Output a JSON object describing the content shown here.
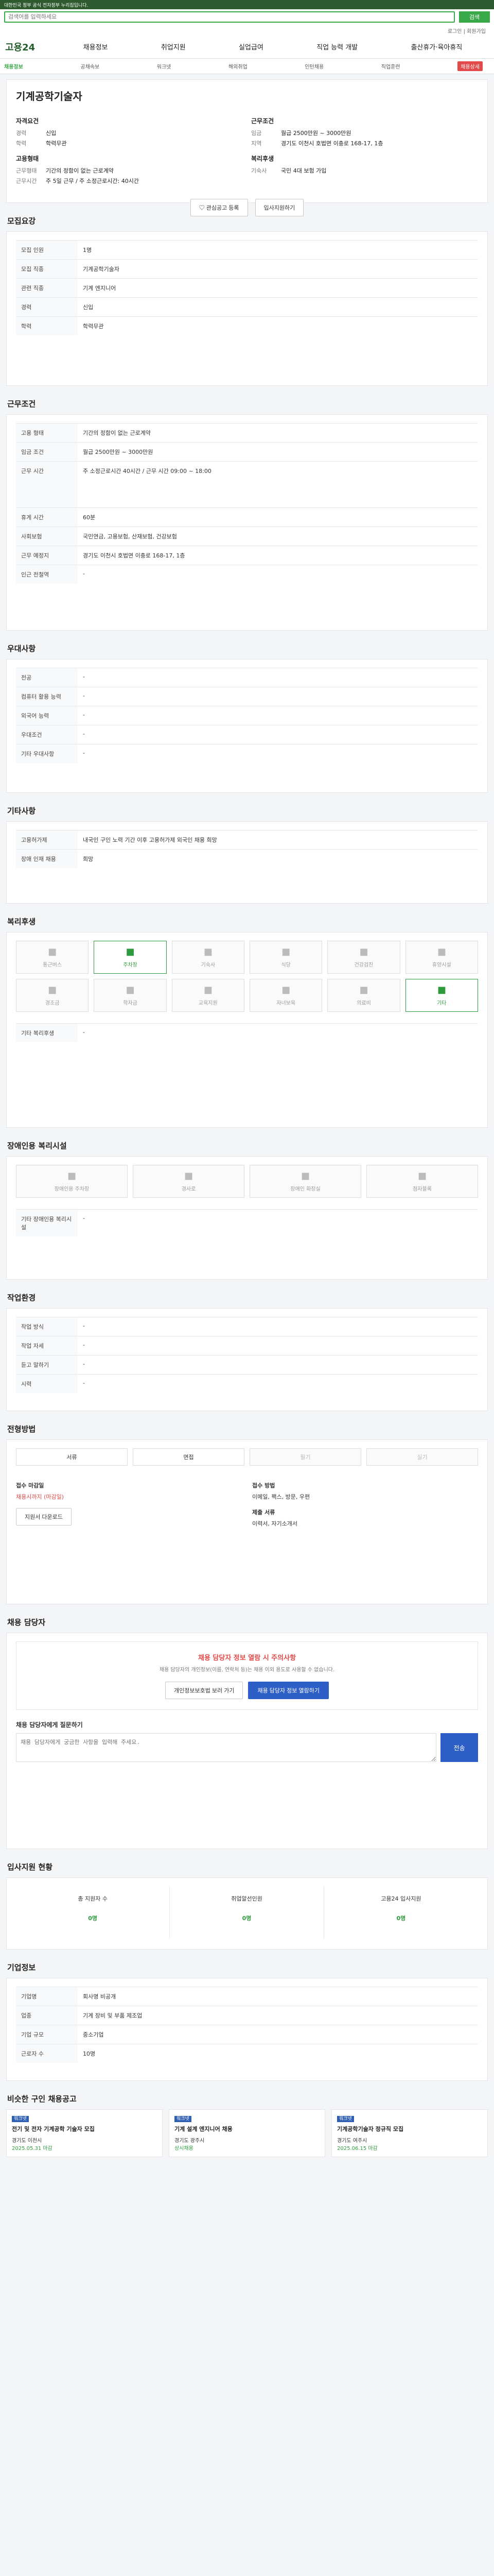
{
  "topbar": {
    "text": "대한민국 정부 공식 전자정부 누리집입니다."
  },
  "search": {
    "placeholder": "검색어를 입력하세요",
    "button": "검색"
  },
  "utility": {
    "links": "로그인 | 회원가입"
  },
  "header": {
    "logo": "고용24",
    "nav": [
      "채용정보",
      "취업지원",
      "실업급여",
      "직업 능력 개발",
      "출산휴가·육아휴직"
    ]
  },
  "subnav": {
    "items": [
      "채용정보",
      "공채속보",
      "워크넷",
      "해외취업",
      "인턴채용",
      "직업훈련"
    ],
    "badge": "채용상세"
  },
  "hero": {
    "title": "기계공학기술자",
    "left": {
      "title": "자격요건",
      "rows": [
        {
          "k": "경력",
          "v": "신입"
        },
        {
          "k": "학력",
          "v": "학력무관"
        }
      ],
      "title2": "고용형태",
      "rows2": [
        {
          "k": "근무형태",
          "v": "기간의 정함이 없는 근로계약"
        },
        {
          "k": "근무시간",
          "v": "주 5일 근무 / 주 소정근로시간: 40시간"
        }
      ]
    },
    "right": {
      "title": "근무조건",
      "rows": [
        {
          "k": "임금",
          "v": "월급 2500만원 ~ 3000만원"
        },
        {
          "k": "지역",
          "v": "경기도 이천시 호법면 이충로 168-17, 1층"
        }
      ],
      "title2": "복리후생",
      "rows2": [
        {
          "k": "기숙사",
          "v": "국민 4대 보험 가입"
        }
      ]
    },
    "btn_a": "관심공고 등록",
    "btn_b": "입사지원하기"
  },
  "sections": {
    "duty": "모집요강",
    "work": "근무조건",
    "pref": "우대사항",
    "other": "기타사항",
    "welfare": "복리후생",
    "disabled": "장애인용 복리시설",
    "env": "작업환경",
    "method": "전형방법",
    "manager": "채용 담당자",
    "status": "입사지원 현황",
    "company": "기업정보",
    "recommend": "비슷한 구인 채용공고"
  },
  "duty_rows": [
    {
      "k": "모집 인원",
      "v": "1명"
    },
    {
      "k": "모집 직종",
      "v": "기계공학기술자"
    },
    {
      "k": "관련 직종",
      "v": "기계 엔지니어"
    },
    {
      "k": "경력",
      "v": "신입"
    },
    {
      "k": "학력",
      "v": "학력무관"
    }
  ],
  "work_rows": [
    {
      "k": "고용 형태",
      "v": "기간의 정함이 없는 근로계약"
    },
    {
      "k": "임금 조건",
      "v": "월급 2500만원 ~ 3000만원"
    },
    {
      "k": "근무 시간",
      "v": "주 소정근로시간 40시간 / 근무 시간 09:00 ~ 18:00"
    },
    {
      "k": "휴게 시간",
      "v": "60분"
    },
    {
      "k": "사회보험",
      "v": "국민연금, 고용보험, 산재보험, 건강보험"
    },
    {
      "k": "근무 예정지",
      "v": "경기도 이천시 호법면 이충로 168-17, 1층"
    },
    {
      "k": "인근 전철역",
      "v": "-"
    }
  ],
  "pref_rows": [
    {
      "k": "전공",
      "v": "-"
    },
    {
      "k": "컴퓨터 활용 능력",
      "v": "-"
    },
    {
      "k": "외국어 능력",
      "v": "-"
    },
    {
      "k": "우대조건",
      "v": "-"
    },
    {
      "k": "기타 우대사항",
      "v": "-"
    }
  ],
  "other_rows": [
    {
      "k": "고용허가제",
      "v": "내국인 구인 노력 기간 이후 고용허가제 외국인 채용 희망"
    },
    {
      "k": "장애 인재 채용",
      "v": "희망"
    }
  ],
  "welfare_icons": [
    "통근버스",
    "주차장",
    "기숙사",
    "식당",
    "건강검진",
    "휴양시설",
    "경조금",
    "학자금",
    "교육지원",
    "자녀보육",
    "의료비",
    "기타"
  ],
  "welfare_text": "기타 복리후생",
  "welfare_value": "-",
  "disabled_icons": [
    "장애인용 주차장",
    "경사로",
    "장애인 화장실",
    "점자블록"
  ],
  "disabled_text": "기타 장애인용 복리시설",
  "disabled_value": "-",
  "env_rows": [
    {
      "k": "작업 방식",
      "v": "-"
    },
    {
      "k": "작업 자세",
      "v": "-"
    },
    {
      "k": "듣고 말하기",
      "v": "-"
    },
    {
      "k": "시력",
      "v": "-"
    }
  ],
  "methods": [
    "서류",
    "면접",
    "필기",
    "실기"
  ],
  "method_info": {
    "l1": "접수 마감일",
    "v1": "채용시까지 (마감일)",
    "l2": "접수 방법",
    "v2": "이메일, 팩스, 방문, 우편",
    "btn": "지원서 다운로드",
    "l3": "제출 서류",
    "v3": "이력서, 자기소개서"
  },
  "manager": {
    "notice": "채용 담당자 정보 열람 시 주의사항",
    "desc": "채용 담당자의 개인정보(이름, 연락처 등)는 채용 이외 용도로 사용할 수 없습니다.",
    "btn_a": "개인정보보호법 보러 가기",
    "btn_b": "채용 담당자 정보 열람하기",
    "ask": "채용 담당자에게 질문하기",
    "placeholder": "채용 담당자에게 궁금한 사항을 입력해 주세요.",
    "send": "전송"
  },
  "status_items": [
    {
      "l": "총 지원자 수",
      "v": "0명"
    },
    {
      "l": "취업알선인원",
      "v": "0명"
    },
    {
      "l": "고용24 입사지원",
      "v": "0명"
    }
  ],
  "company_rows": [
    {
      "k": "기업명",
      "v": "회사명 비공개"
    },
    {
      "k": "업종",
      "v": "기계 장비 및 부품 제조업"
    },
    {
      "k": "기업 규모",
      "v": "중소기업"
    },
    {
      "k": "근로자 수",
      "v": "10명"
    }
  ],
  "recommend": [
    {
      "tag": "워크넷",
      "t": "전기 및 전자 기계공학 기술자 모집",
      "loc": "경기도 이천시",
      "date": "2025.05.31 마감"
    },
    {
      "tag": "워크넷",
      "t": "기계 설계 엔지니어 채용",
      "loc": "경기도 광주시",
      "date": "상시채용"
    },
    {
      "tag": "워크넷",
      "t": "기계공학기술자 정규직 모집",
      "loc": "경기도 여주시",
      "date": "2025.06.15 마감"
    }
  ]
}
